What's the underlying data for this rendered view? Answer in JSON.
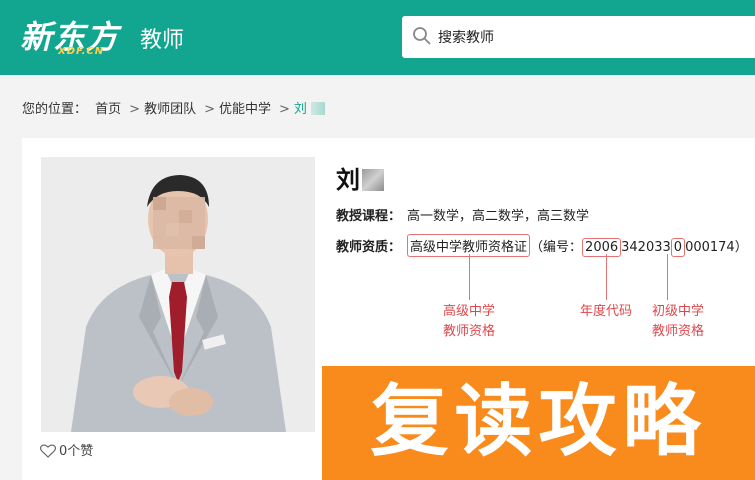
{
  "header": {
    "logo_main": "新东方",
    "logo_sub": "XDF.CN",
    "title": "教师",
    "search_value": "搜索教师"
  },
  "breadcrumb": {
    "prefix": "您的位置：",
    "items": [
      "首页",
      "教师团队",
      "优能中学"
    ],
    "current": "刘"
  },
  "teacher": {
    "name": "刘",
    "courses_label": "教授课程：",
    "courses": "高一数学，高二数学，高三数学",
    "qualification_label": "教师资质：",
    "qualification": "高级中学教师资格证",
    "number_prefix": "（编号：",
    "number_year": "2006",
    "number_mid": "342033",
    "number_level": "0",
    "number_end": "000174）",
    "likes": "0个赞"
  },
  "annotations": {
    "a1": [
      "高级中学",
      "教师资格"
    ],
    "a2": "年度代码",
    "a3": [
      "初级中学",
      "教师资格"
    ]
  },
  "banner": {
    "text": "复读攻略"
  },
  "colors": {
    "brand": "#12a58f",
    "banner": "#f98b1c",
    "annotation": "#e0474c"
  }
}
